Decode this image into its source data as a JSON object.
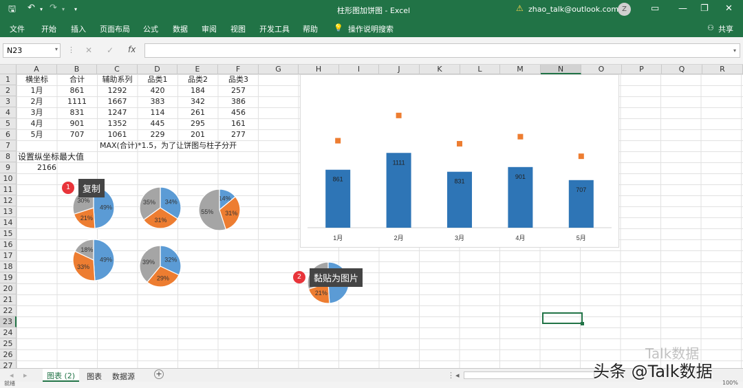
{
  "window": {
    "title": "柱形图加饼图 - Excel",
    "account": "zhao_talk@outlook.com",
    "avatar_letter": "Z"
  },
  "ribbon": {
    "tabs": [
      "文件",
      "开始",
      "插入",
      "页面布局",
      "公式",
      "数据",
      "审阅",
      "视图",
      "开发工具",
      "帮助"
    ],
    "tell_me": "操作说明搜索",
    "share": "共享"
  },
  "formula_bar": {
    "name_box": "N23",
    "cancel": "✕",
    "enter": "✓",
    "fx": "fx",
    "formula": ""
  },
  "columns": [
    "A",
    "B",
    "C",
    "D",
    "E",
    "F",
    "G",
    "H",
    "I",
    "J",
    "K",
    "L",
    "M",
    "N",
    "O",
    "P",
    "Q",
    "R"
  ],
  "rows": [
    "1",
    "2",
    "3",
    "4",
    "5",
    "6",
    "7",
    "8",
    "9",
    "10",
    "11",
    "12",
    "13",
    "14",
    "15",
    "16",
    "17",
    "18",
    "19",
    "20",
    "21",
    "22",
    "23",
    "24",
    "25",
    "26",
    "27"
  ],
  "table": {
    "headers": [
      "横坐标",
      "合计",
      "辅助系列",
      "品类1",
      "品类2",
      "品类3"
    ],
    "rows": [
      [
        "1月",
        "861",
        "1292",
        "420",
        "184",
        "257"
      ],
      [
        "2月",
        "1111",
        "1667",
        "383",
        "342",
        "386"
      ],
      [
        "3月",
        "831",
        "1247",
        "114",
        "261",
        "456"
      ],
      [
        "4月",
        "901",
        "1352",
        "445",
        "295",
        "161"
      ],
      [
        "5月",
        "707",
        "1061",
        "229",
        "201",
        "277"
      ]
    ]
  },
  "notes": {
    "c7": "MAX(合计)*1.5，为了让饼图与柱子分开",
    "a8": "设置纵坐标最大值",
    "b9": "2166"
  },
  "chart_data": {
    "type": "bar",
    "categories": [
      "1月",
      "2月",
      "3月",
      "4月",
      "5月"
    ],
    "series": [
      {
        "name": "合计",
        "values": [
          861,
          1111,
          831,
          901,
          707
        ],
        "color": "#2e75b6"
      },
      {
        "name": "辅助系列",
        "values": [
          1292,
          1667,
          1247,
          1352,
          1061
        ],
        "color": "#ed7d31",
        "style": "marker"
      }
    ],
    "ylim": [
      0,
      2166
    ],
    "data_labels": [
      "861",
      "1111",
      "831",
      "901",
      "707"
    ]
  },
  "pies": [
    {
      "slices": [
        49,
        21,
        30
      ],
      "labels": [
        "49%",
        "21%",
        "30%"
      ]
    },
    {
      "slices": [
        34,
        31,
        35
      ],
      "labels": [
        "34%",
        "31%",
        "35%"
      ]
    },
    {
      "slices": [
        14,
        31,
        55
      ],
      "labels": [
        "14%",
        "31%",
        "55%"
      ]
    },
    {
      "slices": [
        49,
        33,
        18
      ],
      "labels": [
        "49%",
        "33%",
        "18%"
      ]
    },
    {
      "slices": [
        32,
        29,
        39
      ],
      "labels": [
        "32%",
        "29%",
        "39%"
      ]
    },
    {
      "slices": [
        49,
        21,
        30
      ],
      "labels": [
        "",
        "21%",
        ""
      ]
    }
  ],
  "pie_colors": [
    "#5b9bd5",
    "#ed7d31",
    "#a5a5a5"
  ],
  "callouts": [
    {
      "num": "1",
      "text": "复制"
    },
    {
      "num": "2",
      "text": "黏贴为图片"
    }
  ],
  "sheets": [
    "图表 (2)",
    "图表",
    "数据源"
  ],
  "status": {
    "mode": "就绪",
    "zoom": "100%"
  },
  "watermark": {
    "small": "Talk数据",
    "large": "头条 @Talk数据"
  }
}
